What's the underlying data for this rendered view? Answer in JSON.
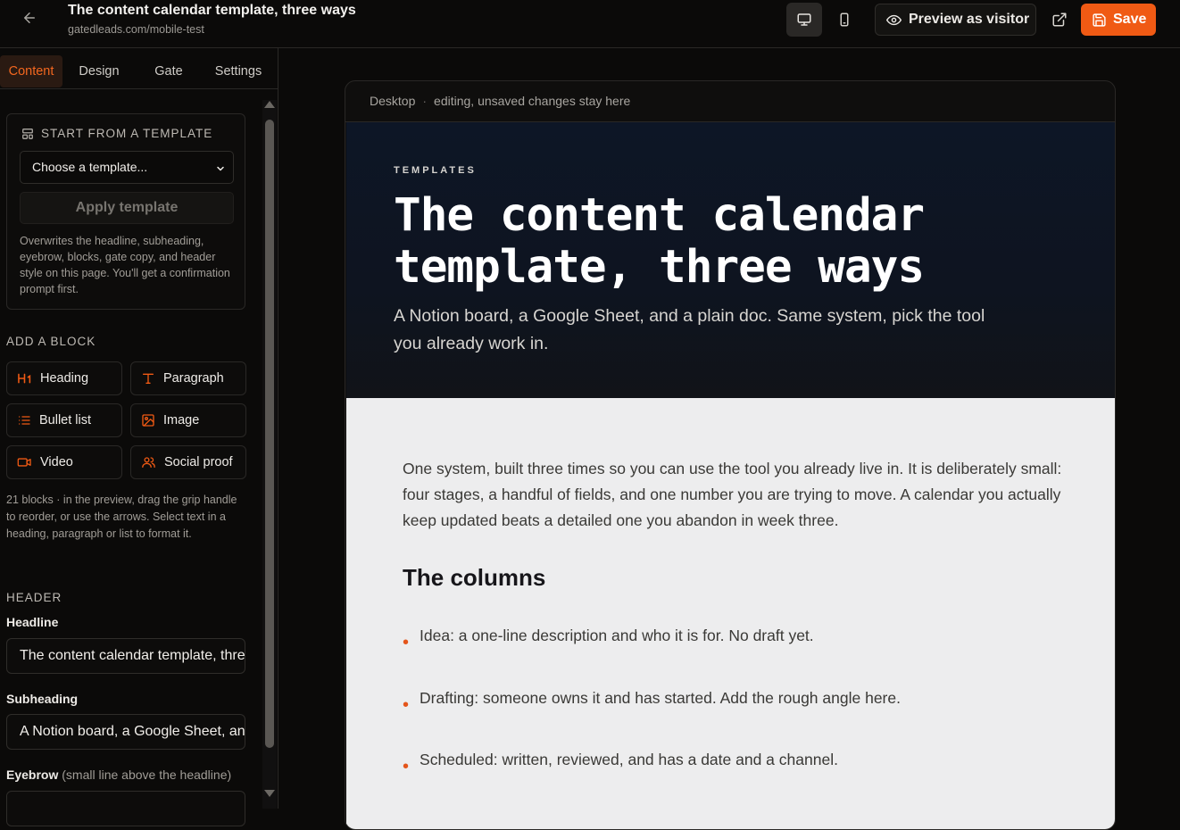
{
  "topbar": {
    "title": "The content calendar template, three ways",
    "url": "gatedleads.com/mobile-test",
    "preview_label": "Preview as visitor",
    "save_label": "Save"
  },
  "sidebar": {
    "tabs": [
      {
        "label": "Content",
        "active": true
      },
      {
        "label": "Design",
        "active": false
      },
      {
        "label": "Gate",
        "active": false
      },
      {
        "label": "Settings",
        "active": false
      }
    ],
    "template": {
      "heading": "START FROM A TEMPLATE",
      "select_value": "Choose a template...",
      "apply_label": "Apply template",
      "note": "Overwrites the headline, subheading, eyebrow, blocks, gate copy, and header style on this page. You'll get a confirmation prompt first."
    },
    "add_block": {
      "heading": "ADD A BLOCK",
      "items": [
        {
          "label": "Heading",
          "icon": "heading-icon"
        },
        {
          "label": "Paragraph",
          "icon": "paragraph-icon"
        },
        {
          "label": "Bullet list",
          "icon": "bullet-list-icon"
        },
        {
          "label": "Image",
          "icon": "image-icon"
        },
        {
          "label": "Video",
          "icon": "video-icon"
        },
        {
          "label": "Social proof",
          "icon": "users-icon"
        }
      ],
      "note": "21 blocks · in the preview, drag the grip handle to reorder, or use the arrows. Select text in a heading, paragraph or list to format it."
    },
    "header": {
      "heading": "HEADER",
      "headline_label": "Headline",
      "headline_value": "The content calendar template, three ways",
      "subheading_label": "Subheading",
      "subheading_value": "A Notion board, a Google Sheet, and a plain doc. Same system, pick the tool you already work in.",
      "eyebrow_label": "Eyebrow",
      "eyebrow_hint": "(small line above the headline)"
    }
  },
  "preview": {
    "device": "Desktop",
    "status": "editing, unsaved changes stay here",
    "eyebrow": "TEMPLATES",
    "headline": "The content calendar template, three ways",
    "subheading": "A Notion board, a Google Sheet, and a plain doc. Same system, pick the tool you already work in.",
    "intro": "One system, built three times so you can use the tool you already live in. It is deliberately small: four stages, a handful of fields, and one number you are trying to move. A calendar you actually keep updated beats a detailed one you abandon in week three.",
    "section_title": "The columns",
    "bullets": [
      "Idea: a one-line description and who it is for. No draft yet.",
      "Drafting: someone owns it and has started. Add the rough angle here.",
      "Scheduled: written, reviewed, and has a date and a channel."
    ]
  },
  "colors": {
    "accent": "#f05a14",
    "bullet": "#e4551b",
    "hero_bg": "#0d1626",
    "body_bg": "#ededee"
  }
}
